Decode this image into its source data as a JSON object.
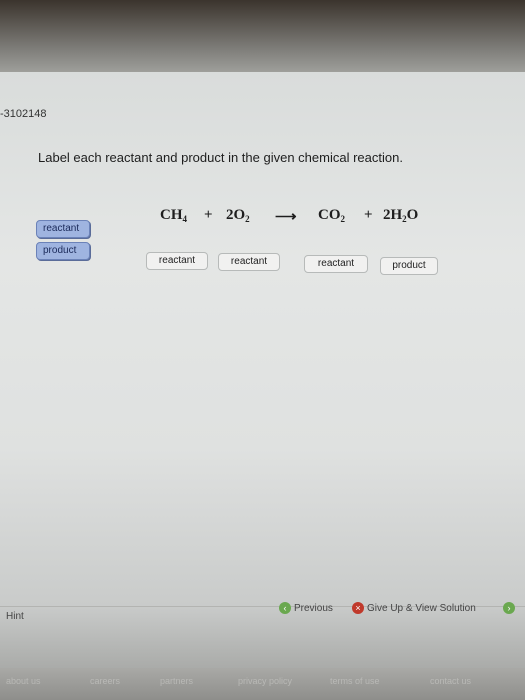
{
  "question_id": "-3102148",
  "instruction": "Label each reactant and product in the given chemical reaction.",
  "equation": {
    "term1": "CH",
    "term1_sub": "4",
    "plus1": "+",
    "term2": "2O",
    "term2_sub": "2",
    "arrow": "⟶",
    "term3": "CO",
    "term3_sub": "2",
    "plus2": "+",
    "term4": "2H",
    "term4_sub": "2",
    "term4_tail": "O"
  },
  "label_bank": [
    "reactant",
    "product"
  ],
  "drop_targets": [
    "reactant",
    "reactant",
    "reactant",
    "product"
  ],
  "footer": {
    "hint": "Hint",
    "previous": "Previous",
    "give_up": "Give Up & View Solution"
  },
  "bottom_links": [
    "about us",
    "careers",
    "partners",
    "privacy policy",
    "terms of use",
    "contact us"
  ]
}
